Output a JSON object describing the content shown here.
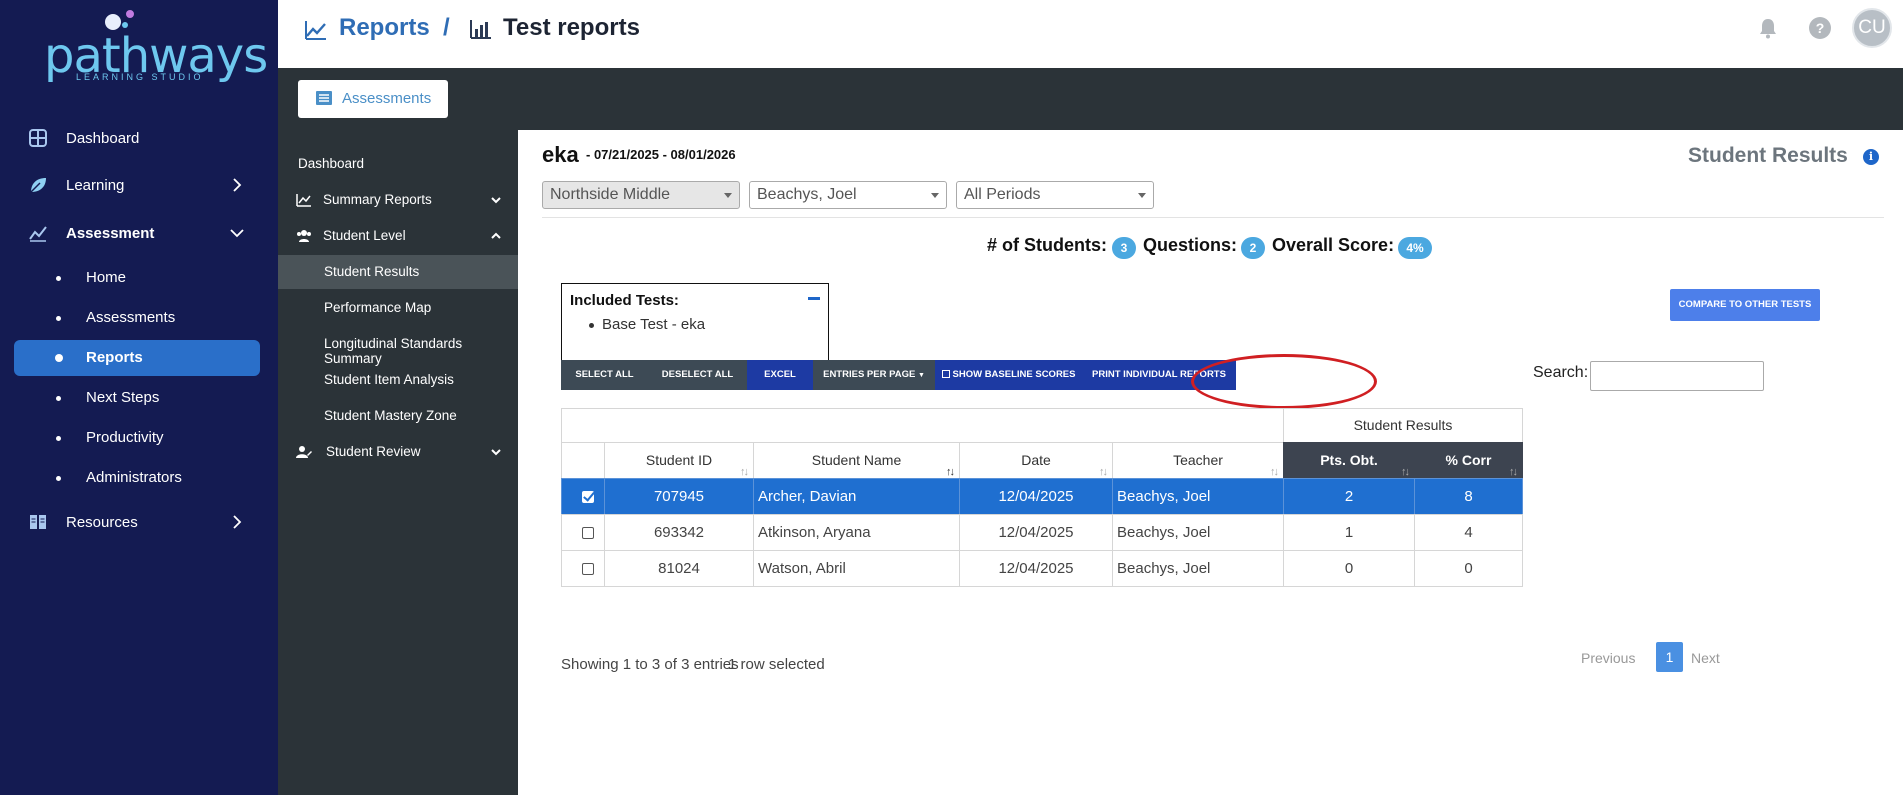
{
  "brand": {
    "name": "pathways",
    "tagline": "LEARNING STUDIO"
  },
  "nav": {
    "items": [
      {
        "label": "Dashboard",
        "icon": "dashboard-grid-icon"
      },
      {
        "label": "Learning",
        "icon": "leaf-icon"
      },
      {
        "label": "Assessment",
        "icon": "chart-line-icon"
      },
      {
        "label": "Resources",
        "icon": "book-icon"
      }
    ],
    "sub": [
      "Home",
      "Assessments",
      "Reports",
      "Next Steps",
      "Productivity",
      "Administrators"
    ],
    "active_sub": "Reports"
  },
  "header": {
    "crumb1": "Reports",
    "sep": "/",
    "crumb2": "Test reports",
    "avatar": "CU"
  },
  "subbar": {
    "assessments_label": "Assessments"
  },
  "sidemenu": {
    "dashboard": "Dashboard",
    "summary": "Summary Reports",
    "student_level": "Student Level",
    "student_results": "Student Results",
    "performance_map": "Performance Map",
    "longitudinal": "Longitudinal Standards Summary",
    "item_analysis": "Student Item Analysis",
    "mastery_zone": "Student Mastery Zone",
    "student_review": "Student Review"
  },
  "main": {
    "test_name": "eka",
    "date_range": "- 07/21/2025 - 08/01/2026",
    "section_title": "Student Results",
    "filters": {
      "school": "Northside Middle",
      "teacher": "Beachys, Joel",
      "period": "All Periods"
    },
    "stats": {
      "students_label": "# of Students:",
      "students": "3",
      "questions_label": "Questions:",
      "questions": "2",
      "score_label": "Overall Score:",
      "score": "4%"
    },
    "included": {
      "title": "Included Tests:",
      "item": "Base Test - eka"
    },
    "compare_btn": "COMPARE TO OTHER TESTS",
    "toolbar": {
      "select_all": "SELECT ALL",
      "deselect_all": "DESELECT ALL",
      "excel": "EXCEL",
      "entries": "ENTRIES PER PAGE",
      "baseline": "SHOW BASELINE SCORES",
      "print": "PRINT INDIVIDUAL REPORTS"
    },
    "search_label": "Search:",
    "table": {
      "group_header": "Student Results",
      "headers": {
        "id": "Student ID",
        "name": "Student Name",
        "date": "Date",
        "teacher": "Teacher",
        "pts": "Pts. Obt.",
        "corr": "% Corr"
      },
      "rows": [
        {
          "id": "707945",
          "name": "Archer, Davian",
          "date": "12/04/2025",
          "teacher": "Beachys, Joel",
          "pts": "2",
          "corr": "8"
        },
        {
          "id": "693342",
          "name": "Atkinson, Aryana",
          "date": "12/04/2025",
          "teacher": "Beachys, Joel",
          "pts": "1",
          "corr": "4"
        },
        {
          "id": "81024",
          "name": "Watson, Abril",
          "date": "12/04/2025",
          "teacher": "Beachys, Joel",
          "pts": "0",
          "corr": "0"
        }
      ]
    },
    "footer": {
      "showing": "Showing 1 to 3 of 3 entries",
      "selected": "1 row selected"
    },
    "pagination": {
      "prev": "Previous",
      "page": "1",
      "next": "Next"
    }
  },
  "colors": {
    "nav_bg": "#141b52",
    "active": "#2a6fc9",
    "dark_bar": "#2b3338",
    "button_blue": "#1d3aa3",
    "selected_row": "#1f6fd0",
    "annotation_circle": "#d01f22"
  }
}
